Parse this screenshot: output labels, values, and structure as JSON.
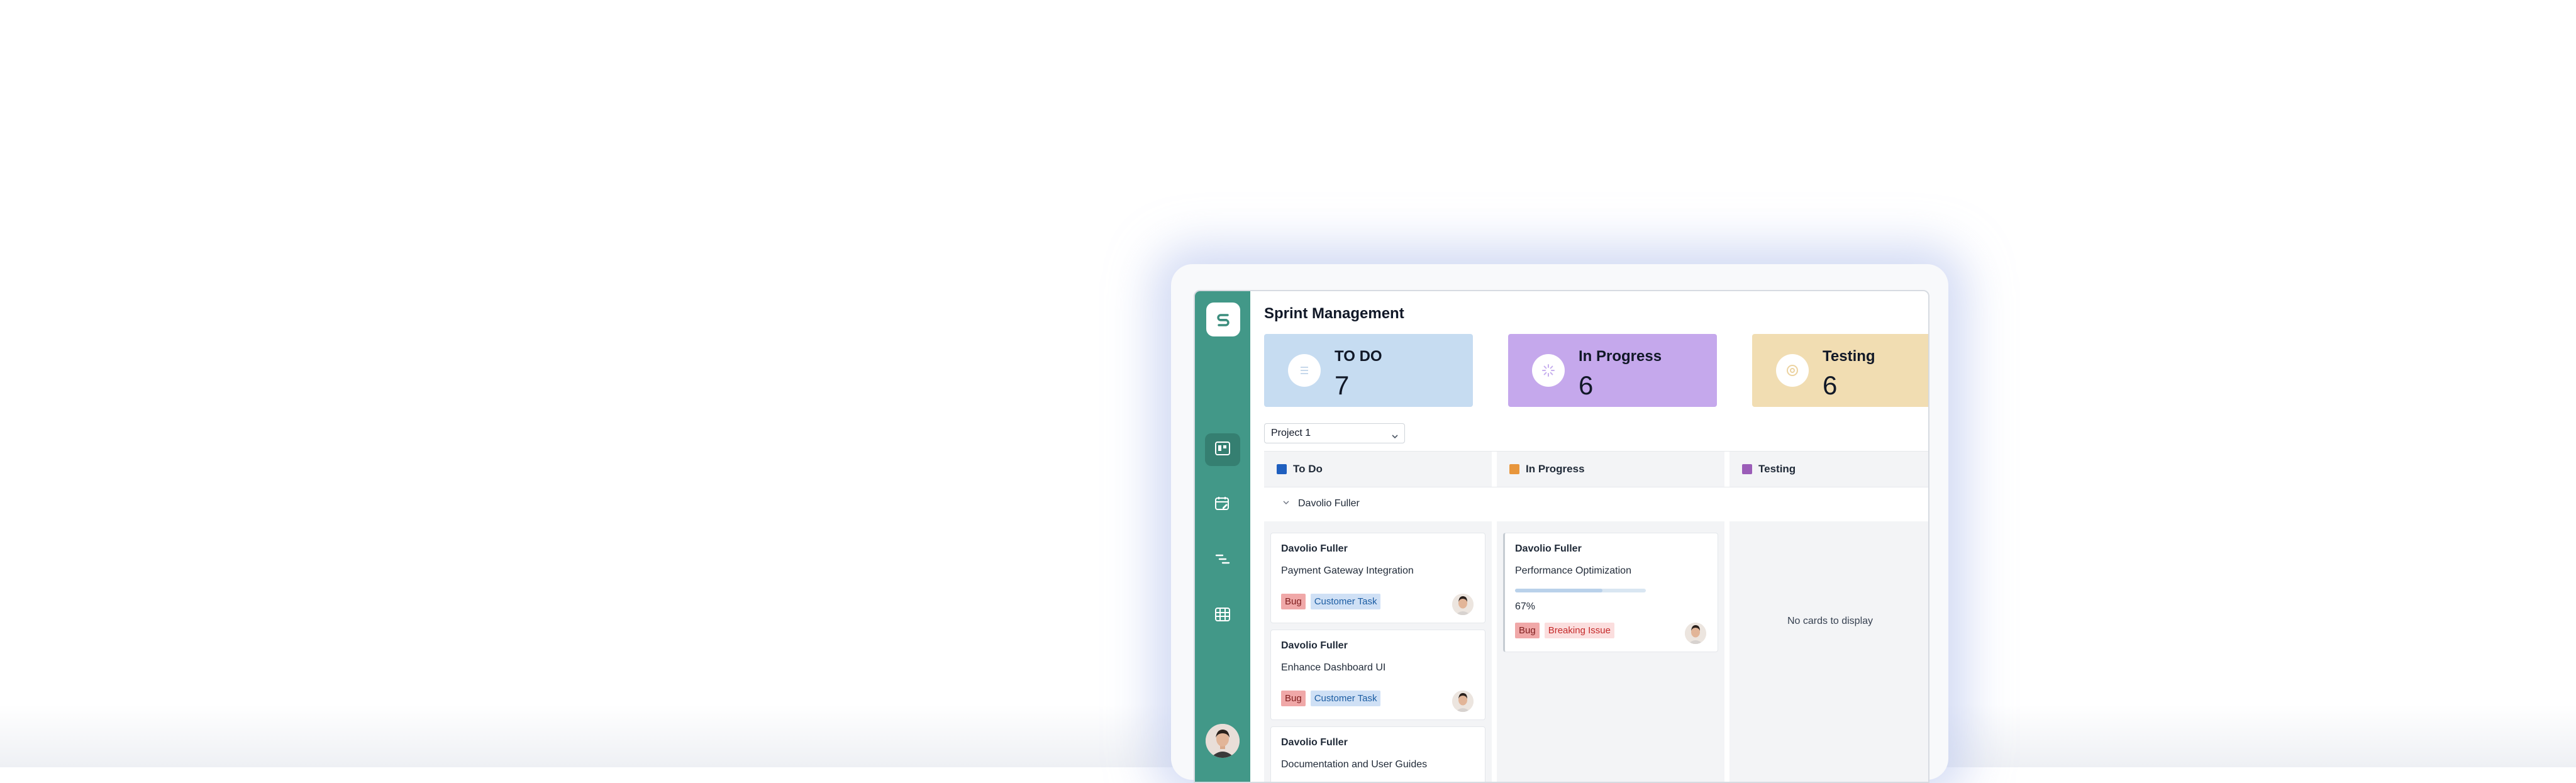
{
  "app": {
    "title": "Sprint Management",
    "sidebar": {
      "logo": "s-logo-icon",
      "items": [
        {
          "name": "kanban-board",
          "icon": "kanban-icon",
          "active": true
        },
        {
          "name": "calendar",
          "icon": "calendar-edit-icon",
          "active": false
        },
        {
          "name": "gantt",
          "icon": "gantt-icon",
          "active": false
        },
        {
          "name": "grid",
          "icon": "table-icon",
          "active": false
        }
      ],
      "user_avatar": "user-avatar"
    },
    "stats": [
      {
        "label": "TO DO",
        "count": "7",
        "color": "#c6dcf1",
        "icon": "list-icon"
      },
      {
        "label": "In Progress",
        "count": "6",
        "color": "#c5a8ec",
        "icon": "spinner-icon"
      },
      {
        "label": "Testing",
        "count": "6",
        "color": "#f1ddb2",
        "icon": "test-gauge-icon"
      }
    ],
    "project_select": {
      "value": "Project 1"
    },
    "columns": [
      {
        "label": "To Do",
        "color": "#1f5fbf"
      },
      {
        "label": "In Progress",
        "color": "#e8963c"
      },
      {
        "label": "Testing",
        "color": "#9b5db8"
      }
    ],
    "swimlane": {
      "label": "Davolio Fuller"
    },
    "todo_cards": [
      {
        "assignee": "Davolio Fuller",
        "summary": "Payment Gateway Integration",
        "tags": [
          "Bug",
          "Customer Task"
        ]
      },
      {
        "assignee": "Davolio Fuller",
        "summary": "Enhance Dashboard UI",
        "tags": [
          "Bug",
          "Customer Task"
        ]
      },
      {
        "assignee": "Davolio Fuller",
        "summary": "Documentation and User Guides",
        "tags": []
      }
    ],
    "inprogress_cards": [
      {
        "assignee": "Davolio Fuller",
        "summary": "Performance Optimization",
        "progress": 0.67,
        "progress_text": "67%",
        "tags": [
          "Bug",
          "Breaking Issue"
        ]
      }
    ],
    "testing": {
      "empty_text": "No cards to display"
    }
  }
}
